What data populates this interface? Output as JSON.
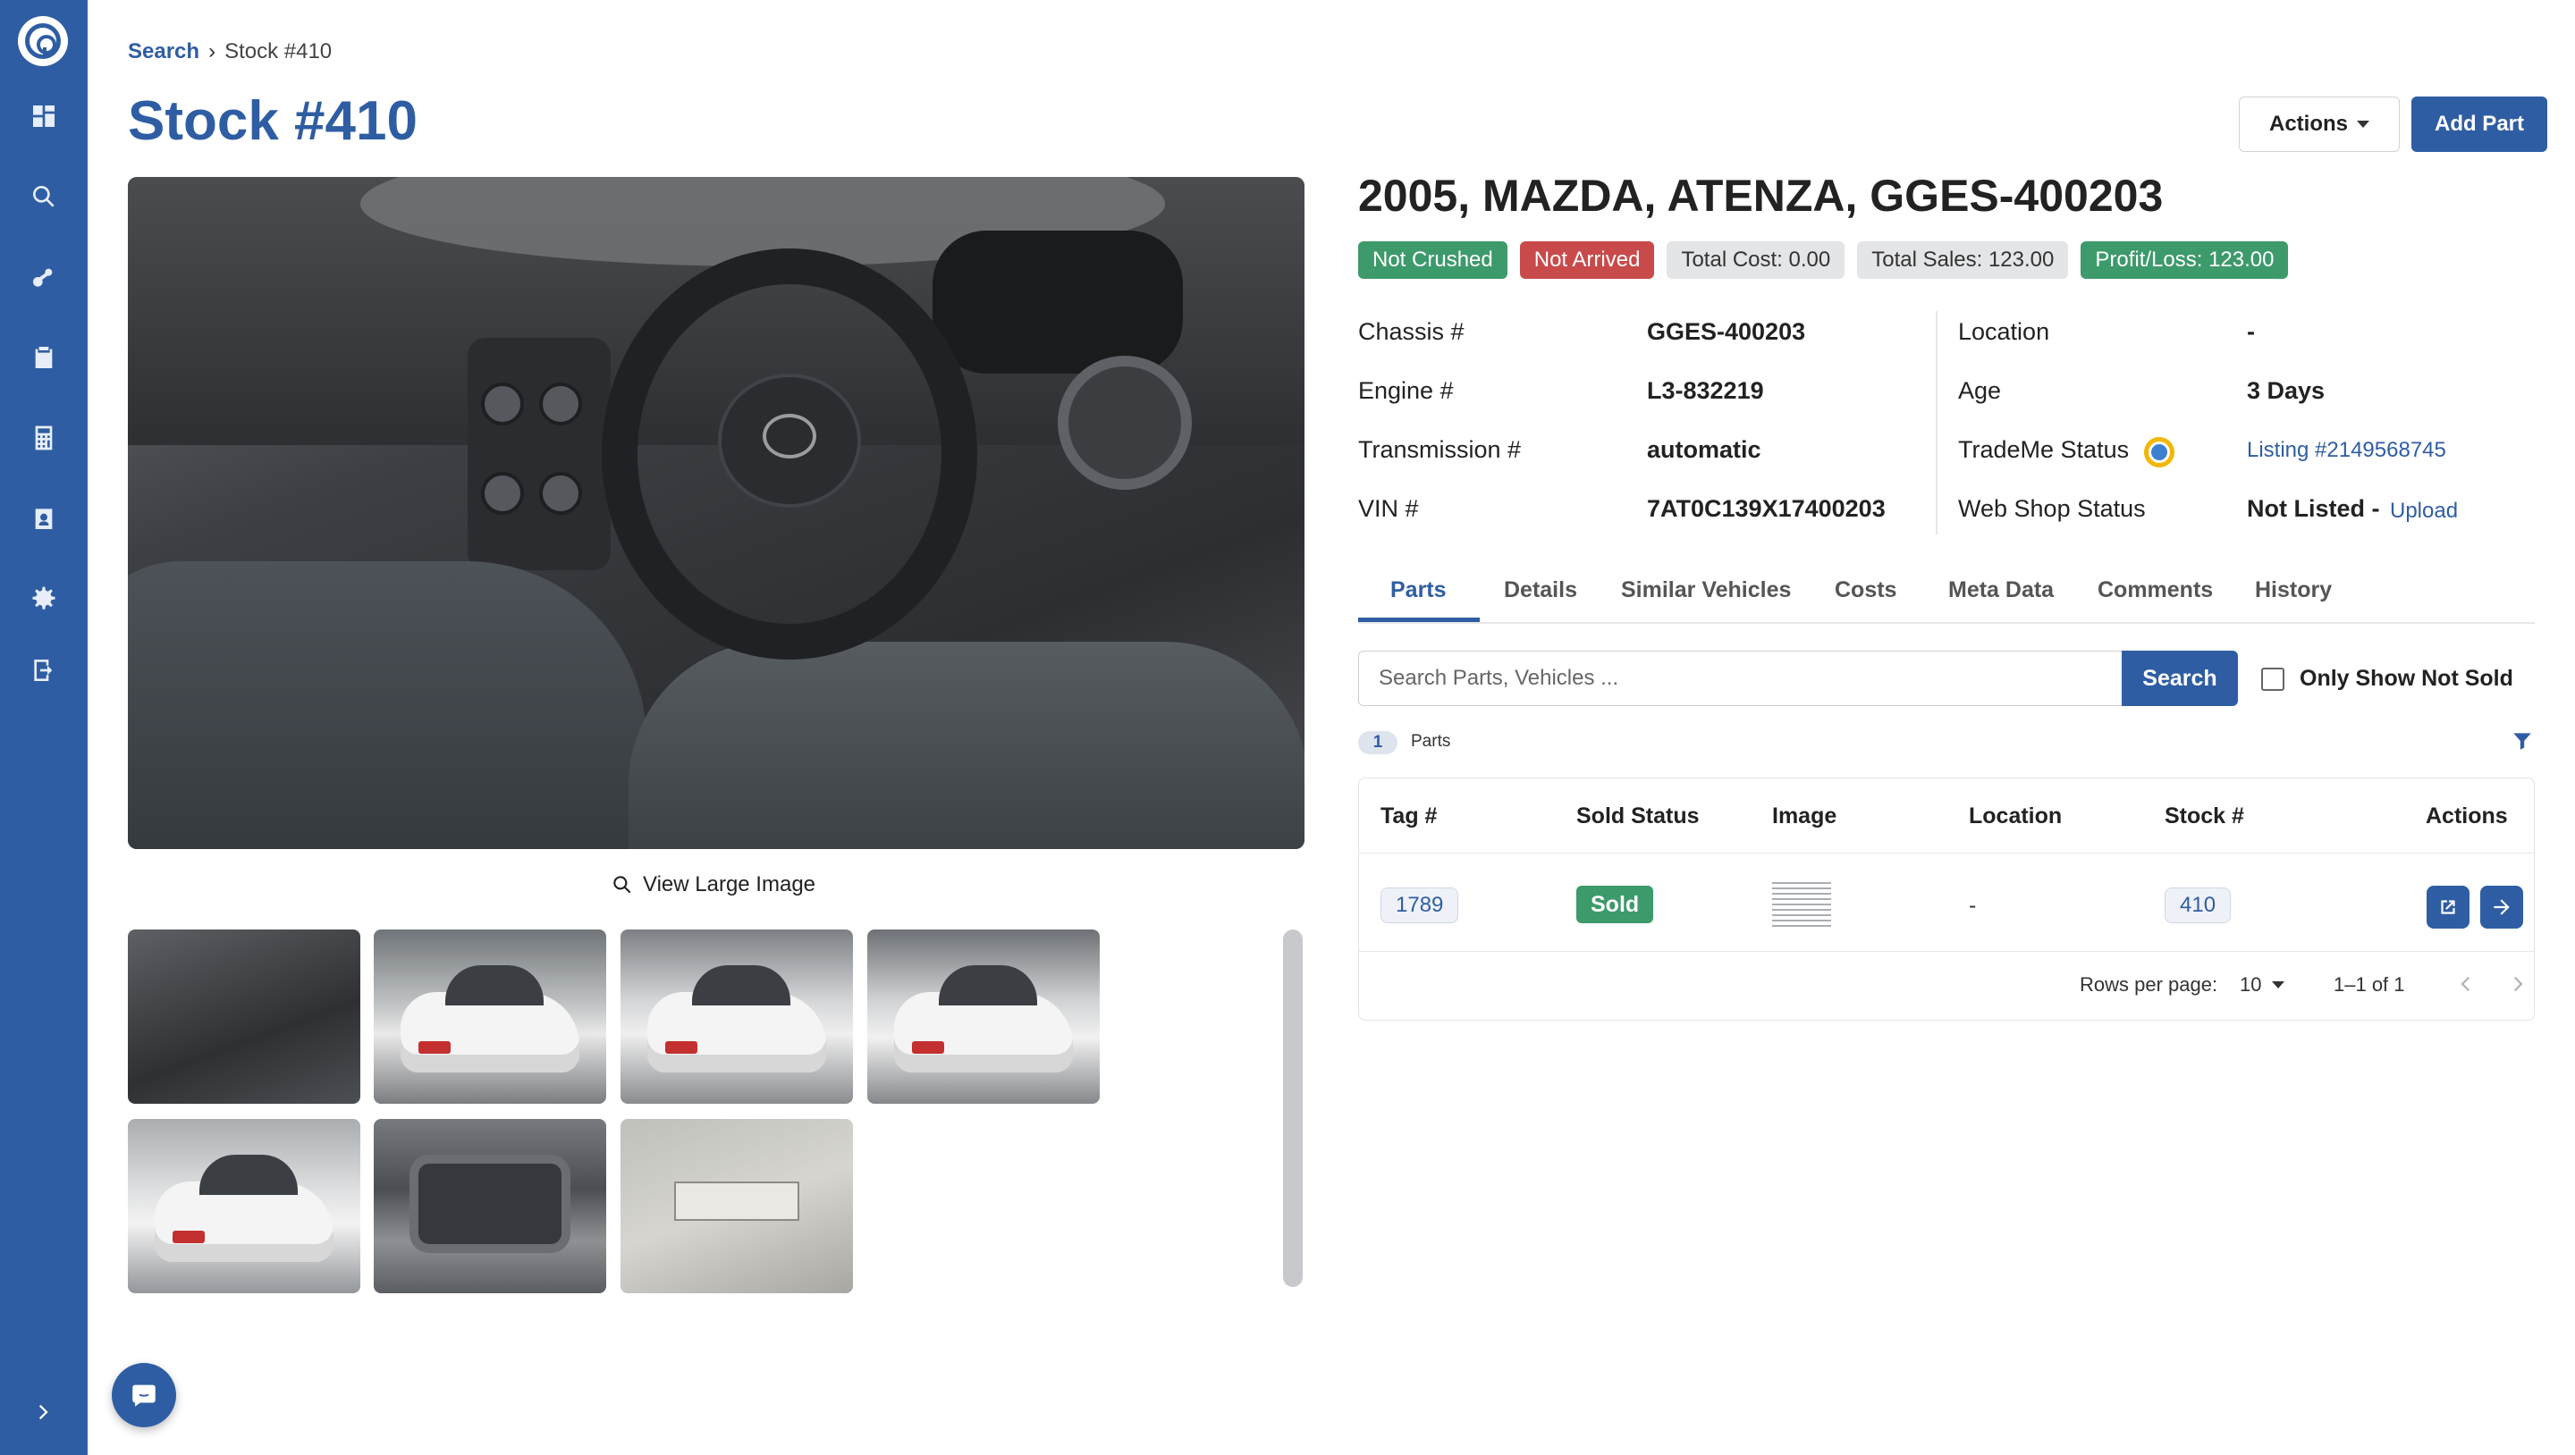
{
  "breadcrumb": {
    "parent": "Search",
    "current": "Stock #410"
  },
  "page_title": "Stock #410",
  "header_actions": {
    "actions_label": "Actions",
    "add_part_label": "Add Part"
  },
  "sidebar": {
    "items": [
      {
        "name": "dashboard-icon"
      },
      {
        "name": "search-icon"
      },
      {
        "name": "parts-icon"
      },
      {
        "name": "clipboard-icon"
      },
      {
        "name": "calculator-icon"
      },
      {
        "name": "badge-icon"
      },
      {
        "name": "settings-icon"
      },
      {
        "name": "logout-icon"
      }
    ],
    "expand_icon": "chevron-right-icon"
  },
  "media": {
    "view_large_label": "View Large Image",
    "thumbnail_count": 7
  },
  "vehicle": {
    "title": "2005, MAZDA, ATENZA, GGES-400203",
    "badges": [
      {
        "label": "Not Crushed",
        "color": "#3d9a6b"
      },
      {
        "label": "Not Arrived",
        "color": "#c94a4a"
      },
      {
        "label": "Total Cost: 0.00",
        "color": "#e4e5e7"
      },
      {
        "label": "Total Sales: 123.00",
        "color": "#e4e5e7"
      },
      {
        "label": "Profit/Loss: 123.00",
        "color": "#3d9a6b"
      }
    ],
    "chassis_label": "Chassis #",
    "chassis": "GGES-400203",
    "engine_label": "Engine #",
    "engine": "L3-832219",
    "transmission_label": "Transmission #",
    "transmission": "automatic",
    "vin_label": "VIN #",
    "vin": "7AT0C139X17400203",
    "location_label": "Location",
    "location": "-",
    "age_label": "Age",
    "age": "3 Days",
    "trademe_label": "TradeMe Status",
    "trademe_link": "Listing #2149568745",
    "webshop_label": "Web Shop Status",
    "webshop_status": "Not Listed -",
    "webshop_upload": "Upload"
  },
  "tabs": [
    "Parts",
    "Details",
    "Similar Vehicles",
    "Costs",
    "Meta Data",
    "Comments",
    "History"
  ],
  "active_tab": "Parts",
  "parts_search": {
    "placeholder": "Search Parts, Vehicles ...",
    "button_label": "Search",
    "only_not_sold_label": "Only Show Not Sold"
  },
  "parts_count": {
    "count": "1",
    "label": "Parts"
  },
  "table": {
    "headers": [
      "Tag #",
      "Sold Status",
      "Image",
      "Location",
      "Stock #",
      "Actions"
    ],
    "rows": [
      {
        "tag": "1789",
        "sold_status": "Sold",
        "location": "-",
        "stock": "410"
      }
    ],
    "rows_per_page_label": "Rows per page:",
    "rows_per_page": "10",
    "range": "1–1 of 1"
  },
  "colors": {
    "brand": "#2f5da3",
    "success": "#3d9a6b",
    "danger": "#c94a4a"
  }
}
